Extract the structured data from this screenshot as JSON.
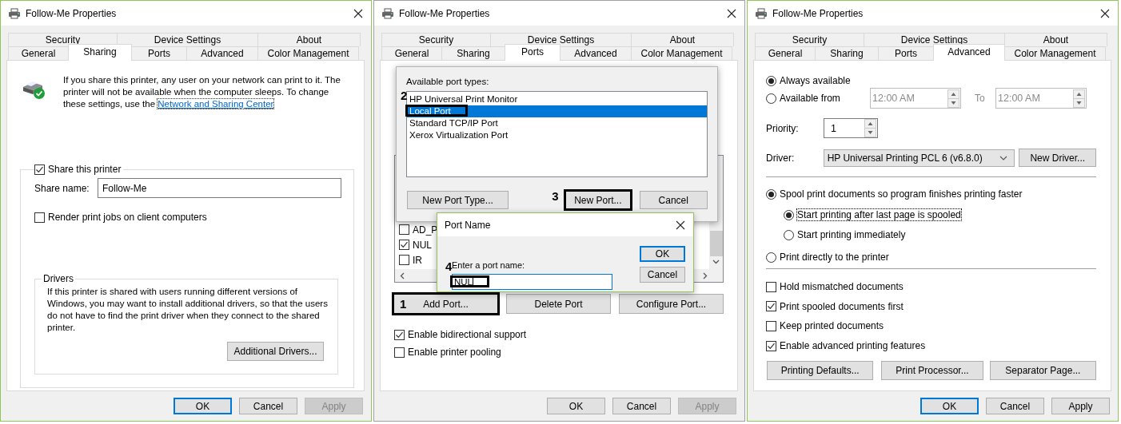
{
  "dialogs": [
    {
      "title": "Follow-Me Properties",
      "active": true,
      "tab_rows": [
        [
          {
            "label": "Security",
            "selected": false
          },
          {
            "label": "Device Settings",
            "selected": false
          },
          {
            "label": "About",
            "selected": false
          }
        ],
        [
          {
            "label": "General",
            "selected": false
          },
          {
            "label": "Sharing",
            "selected": true
          },
          {
            "label": "Ports",
            "selected": false
          },
          {
            "label": "Advanced",
            "selected": false
          },
          {
            "label": "Color Management",
            "selected": false
          }
        ]
      ],
      "page": {
        "kind": "sharing",
        "description": "If you share this printer, any user on your network can print to it. The printer will not be available when the computer sleeps. To change these settings, use the",
        "link": "Network and Sharing Center",
        "share_checkbox": {
          "label": "Share this printer",
          "checked": true
        },
        "share_name": {
          "label": "Share name:",
          "value": "Follow-Me"
        },
        "render_checkbox": {
          "label": "Render print jobs on client computers",
          "checked": false
        },
        "drivers": {
          "title": "Drivers",
          "text": "If this printer is shared with users running different versions of Windows, you may want to install additional drivers, so that the users do not have to find the print driver when they connect to the shared printer.",
          "button": "Additional Drivers..."
        }
      },
      "buttons": [
        {
          "label": "OK",
          "default": true,
          "disabled": false
        },
        {
          "label": "Cancel",
          "default": false,
          "disabled": false
        },
        {
          "label": "Apply",
          "default": false,
          "disabled": true
        }
      ]
    },
    {
      "title": "Follow-Me Properties",
      "active": false,
      "tab_rows": [
        [
          {
            "label": "Security",
            "selected": false
          },
          {
            "label": "Device Settings",
            "selected": false
          },
          {
            "label": "About",
            "selected": false
          }
        ],
        [
          {
            "label": "General",
            "selected": false
          },
          {
            "label": "Sharing",
            "selected": false
          },
          {
            "label": "Ports",
            "selected": true
          },
          {
            "label": "Advanced",
            "selected": false
          },
          {
            "label": "Color Management",
            "selected": false
          }
        ]
      ],
      "page": {
        "kind": "ports",
        "ports": [
          {
            "name": "AD_P",
            "checked": false
          },
          {
            "name": "NUL",
            "checked": true
          },
          {
            "name": "IR",
            "checked": false
          }
        ],
        "port_buttons": [
          {
            "label": "Add Port...",
            "callout": "1"
          },
          {
            "label": "Delete Port"
          },
          {
            "label": "Configure Port..."
          }
        ],
        "options": [
          {
            "label": "Enable bidirectional support",
            "checked": true
          },
          {
            "label": "Enable printer pooling",
            "checked": false
          }
        ],
        "printer_ports_dialog": {
          "heading": "Available port types:",
          "port_types": [
            {
              "name": "HP Universal Print Monitor",
              "selected": false
            },
            {
              "name": "Local Port",
              "selected": true,
              "callout": "2"
            },
            {
              "name": "Standard TCP/IP Port",
              "selected": false
            },
            {
              "name": "Xerox Virtualization Port",
              "selected": false
            }
          ],
          "buttons": [
            {
              "label": "New Port Type..."
            },
            {
              "label": "New Port...",
              "callout": "3"
            },
            {
              "label": "Cancel"
            }
          ]
        },
        "port_name_dialog": {
          "title": "Port Name",
          "prompt": "Enter a port name:",
          "value": "NUL",
          "callout": "4",
          "buttons": [
            {
              "label": "OK",
              "default": true
            },
            {
              "label": "Cancel",
              "default": false
            }
          ]
        }
      },
      "buttons": [
        {
          "label": "OK",
          "default": false,
          "disabled": false
        },
        {
          "label": "Cancel",
          "default": false,
          "disabled": false
        },
        {
          "label": "Apply",
          "default": false,
          "disabled": true
        }
      ]
    },
    {
      "title": "Follow-Me Properties",
      "active": true,
      "tab_rows": [
        [
          {
            "label": "Security",
            "selected": false
          },
          {
            "label": "Device Settings",
            "selected": false
          },
          {
            "label": "About",
            "selected": false
          }
        ],
        [
          {
            "label": "General",
            "selected": false
          },
          {
            "label": "Sharing",
            "selected": false
          },
          {
            "label": "Ports",
            "selected": false
          },
          {
            "label": "Advanced",
            "selected": true
          },
          {
            "label": "Color Management",
            "selected": false
          }
        ]
      ],
      "page": {
        "kind": "advanced",
        "availability": [
          {
            "label": "Always available",
            "selected": true
          },
          {
            "label": "Available from",
            "selected": false
          }
        ],
        "from_time": {
          "value": "12:00 AM",
          "disabled": true
        },
        "to_label": "To",
        "to_time": {
          "value": "12:00 AM",
          "disabled": true
        },
        "priority": {
          "label": "Priority:",
          "value": "1"
        },
        "driver": {
          "label": "Driver:",
          "value": "HP Universal Printing PCL 6 (v6.8.0)",
          "button": "New Driver..."
        },
        "spooling": [
          {
            "label": "Spool print documents so program finishes printing faster",
            "selected": true,
            "children": [
              {
                "label": "Start printing after last page is spooled",
                "selected": true,
                "focused": true
              },
              {
                "label": "Start printing immediately",
                "selected": false
              }
            ]
          },
          {
            "label": "Print directly to the printer",
            "selected": false
          }
        ],
        "options": [
          {
            "label": "Hold mismatched documents",
            "checked": false
          },
          {
            "label": "Print spooled documents first",
            "checked": true
          },
          {
            "label": "Keep printed documents",
            "checked": false
          },
          {
            "label": "Enable advanced printing features",
            "checked": true
          }
        ],
        "buttons": [
          "Printing Defaults...",
          "Print Processor...",
          "Separator Page..."
        ]
      },
      "buttons": [
        {
          "label": "OK",
          "default": true,
          "disabled": false
        },
        {
          "label": "Cancel",
          "default": false,
          "disabled": false
        },
        {
          "label": "Apply",
          "default": false,
          "disabled": false
        }
      ]
    }
  ]
}
